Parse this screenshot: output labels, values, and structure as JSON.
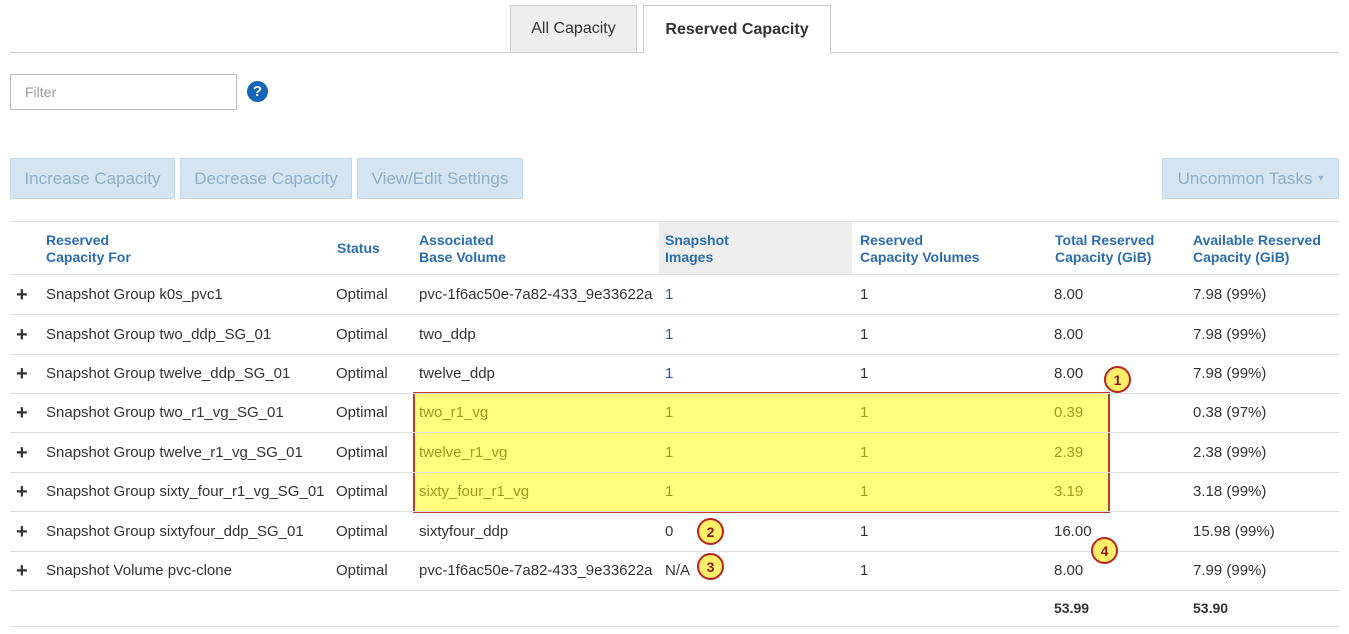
{
  "tabs": [
    {
      "label": "All Capacity"
    },
    {
      "label": "Reserved Capacity"
    }
  ],
  "filter": {
    "placeholder": "Filter",
    "help_icon": "?"
  },
  "buttons": {
    "increase": "Increase Capacity",
    "decrease": "Decrease Capacity",
    "view_edit": "View/Edit Settings",
    "uncommon": "Uncommon Tasks",
    "uncommon_caret": "▾"
  },
  "table": {
    "headers": {
      "reserved_for": [
        "Reserved",
        "Capacity For"
      ],
      "status": "Status",
      "base_volume": [
        "Associated",
        "Base Volume"
      ],
      "snapshot_images": [
        "Snapshot",
        "Images"
      ],
      "reserved_volumes": [
        "Reserved",
        "Capacity Volumes"
      ],
      "total_reserved": [
        "Total Reserved",
        "Capacity (GiB)"
      ],
      "available_reserved": [
        "Available Reserved",
        "Capacity (GiB)"
      ]
    },
    "expander": "+",
    "rows": [
      {
        "name": "Snapshot Group k0s_pvc1",
        "status": "Optimal",
        "base": "pvc-1f6ac50e-7a82-433_9e33622a",
        "images": "1",
        "volumes": "1",
        "total": "8.00",
        "available": "7.98 (99%)"
      },
      {
        "name": "Snapshot Group two_ddp_SG_01",
        "status": "Optimal",
        "base": "two_ddp",
        "images": "1",
        "volumes": "1",
        "total": "8.00",
        "available": "7.98 (99%)"
      },
      {
        "name": "Snapshot Group twelve_ddp_SG_01",
        "status": "Optimal",
        "base": "twelve_ddp",
        "images": "1",
        "volumes": "1",
        "total": "8.00",
        "available": "7.98 (99%)"
      },
      {
        "name": "Snapshot Group two_r1_vg_SG_01",
        "status": "Optimal",
        "base": "two_r1_vg",
        "images": "1",
        "volumes": "1",
        "total": "0.39",
        "available": "0.38 (97%)"
      },
      {
        "name": "Snapshot Group twelve_r1_vg_SG_01",
        "status": "Optimal",
        "base": "twelve_r1_vg",
        "images": "1",
        "volumes": "1",
        "total": "2.39",
        "available": "2.38 (99%)"
      },
      {
        "name": "Snapshot Group sixty_four_r1_vg_SG_01",
        "status": "Optimal",
        "base": "sixty_four_r1_vg",
        "images": "1",
        "volumes": "1",
        "total": "3.19",
        "available": "3.18 (99%)"
      },
      {
        "name": "Snapshot Group sixtyfour_ddp_SG_01",
        "status": "Optimal",
        "base": "sixtyfour_ddp",
        "images": "0",
        "volumes": "1",
        "total": "16.00",
        "available": "15.98 (99%)"
      },
      {
        "name": "Snapshot Volume pvc-clone",
        "status": "Optimal",
        "base": "pvc-1f6ac50e-7a82-433_9e33622a",
        "images": "N/A",
        "volumes": "1",
        "total": "8.00",
        "available": "7.99 (99%)"
      }
    ],
    "totals": {
      "total": "53.99",
      "available": "53.90"
    }
  },
  "callouts": [
    "1",
    "2",
    "3",
    "4"
  ],
  "colors": {
    "highlight_fill": "#ffff7f",
    "highlight_border": "#c0392b",
    "link": "#1a5fa8",
    "header_link": "#2a6db0",
    "button_bg": "#d4e4f1"
  }
}
